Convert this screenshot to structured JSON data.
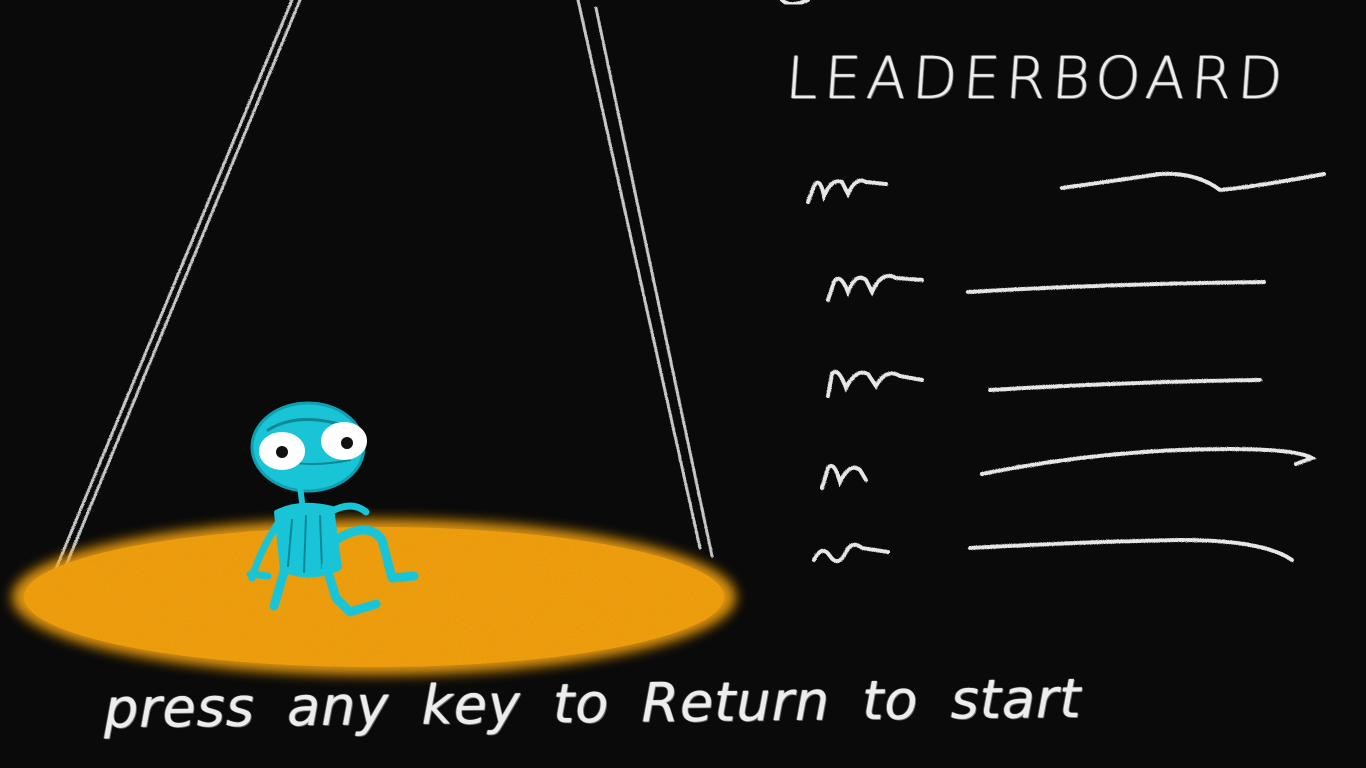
{
  "leaderboard": {
    "title": "LEADERBOARD",
    "row_count": 5
  },
  "prompt": "press any key to Return to start",
  "colors": {
    "background": "#0a0a0a",
    "chalk": "#ededed",
    "spotlight": "#f5a30c",
    "character": "#19c4d6"
  },
  "character": {
    "name": "blue-alien-character"
  }
}
